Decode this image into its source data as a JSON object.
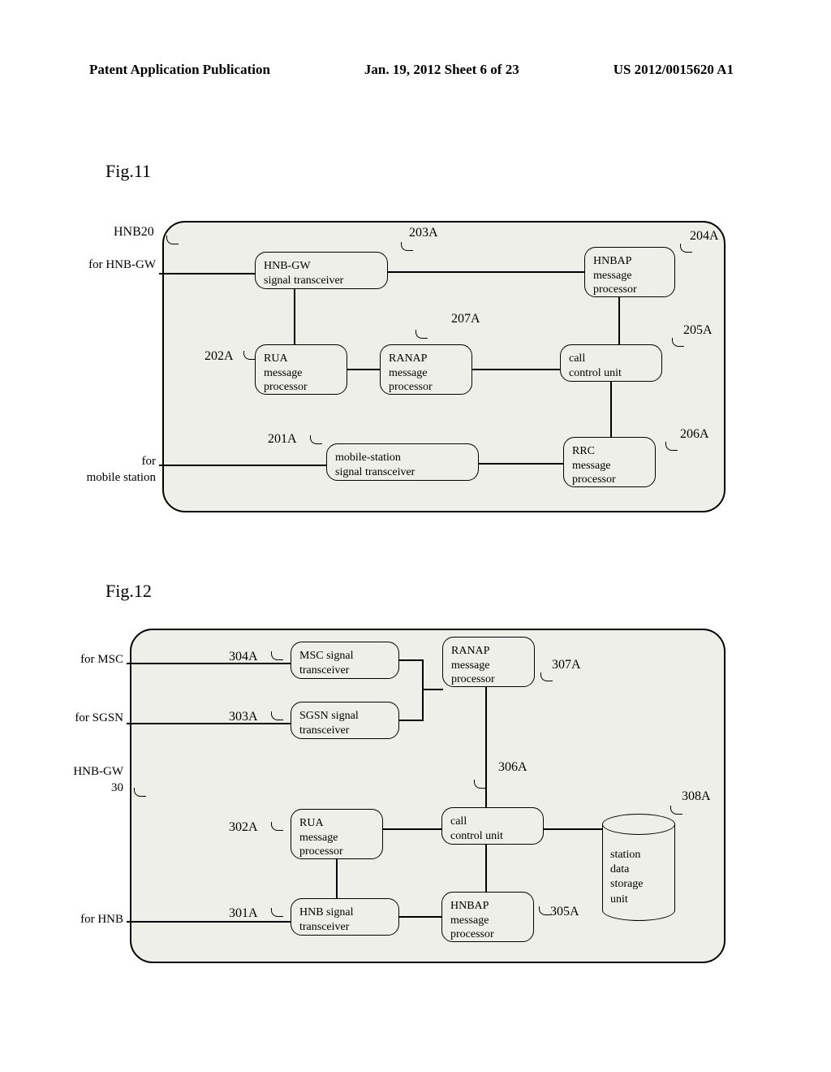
{
  "header": {
    "left": "Patent Application Publication",
    "center": "Jan. 19, 2012  Sheet 6 of 23",
    "right": "US 2012/0015620 A1"
  },
  "fig11": {
    "label": "Fig.11",
    "device": "HNB20",
    "ext_top": "for HNB-GW",
    "ext_bottom_line1": "for",
    "ext_bottom_line2": "mobile station",
    "blocks": {
      "b203": {
        "ref": "203A",
        "l1": "HNB-GW",
        "l2": "signal transceiver"
      },
      "b204": {
        "ref": "204A",
        "l1": "HNBAP",
        "l2": "message",
        "l3": "processor"
      },
      "b202": {
        "ref": "202A",
        "l1": "RUA",
        "l2": "message",
        "l3": "processor"
      },
      "b207": {
        "ref": "207A",
        "l1": "RANAP",
        "l2": "message",
        "l3": "processor"
      },
      "b205": {
        "ref": "205A",
        "l1": "call",
        "l2": "control unit"
      },
      "b201": {
        "ref": "201A",
        "l1": "mobile-station",
        "l2": "signal transceiver"
      },
      "b206": {
        "ref": "206A",
        "l1": "RRC",
        "l2": "message",
        "l3": "processor"
      }
    }
  },
  "fig12": {
    "label": "Fig.12",
    "device_line1": "HNB-GW",
    "device_line2": "30",
    "ext_msc": "for MSC",
    "ext_sgsn": "for SGSN",
    "ext_hnb": "for HNB",
    "blocks": {
      "c304": {
        "ref": "304A",
        "l1": "MSC signal",
        "l2": "transceiver"
      },
      "c307": {
        "ref": "307A",
        "l1": "RANAP",
        "l2": "message",
        "l3": "processor"
      },
      "c303": {
        "ref": "303A",
        "l1": "SGSN signal",
        "l2": "transceiver"
      },
      "c302": {
        "ref": "302A",
        "l1": "RUA",
        "l2": "message",
        "l3": "processor"
      },
      "c306": {
        "ref": "306A",
        "l1": "call",
        "l2": "control unit"
      },
      "c301": {
        "ref": "301A",
        "l1": "HNB signal",
        "l2": "transceiver"
      },
      "c305": {
        "ref": "305A",
        "l1": "HNBAP",
        "l2": "message",
        "l3": "processor"
      },
      "c308": {
        "ref": "308A",
        "l1": "station",
        "l2": "data",
        "l3": "storage",
        "l4": "unit"
      }
    }
  }
}
